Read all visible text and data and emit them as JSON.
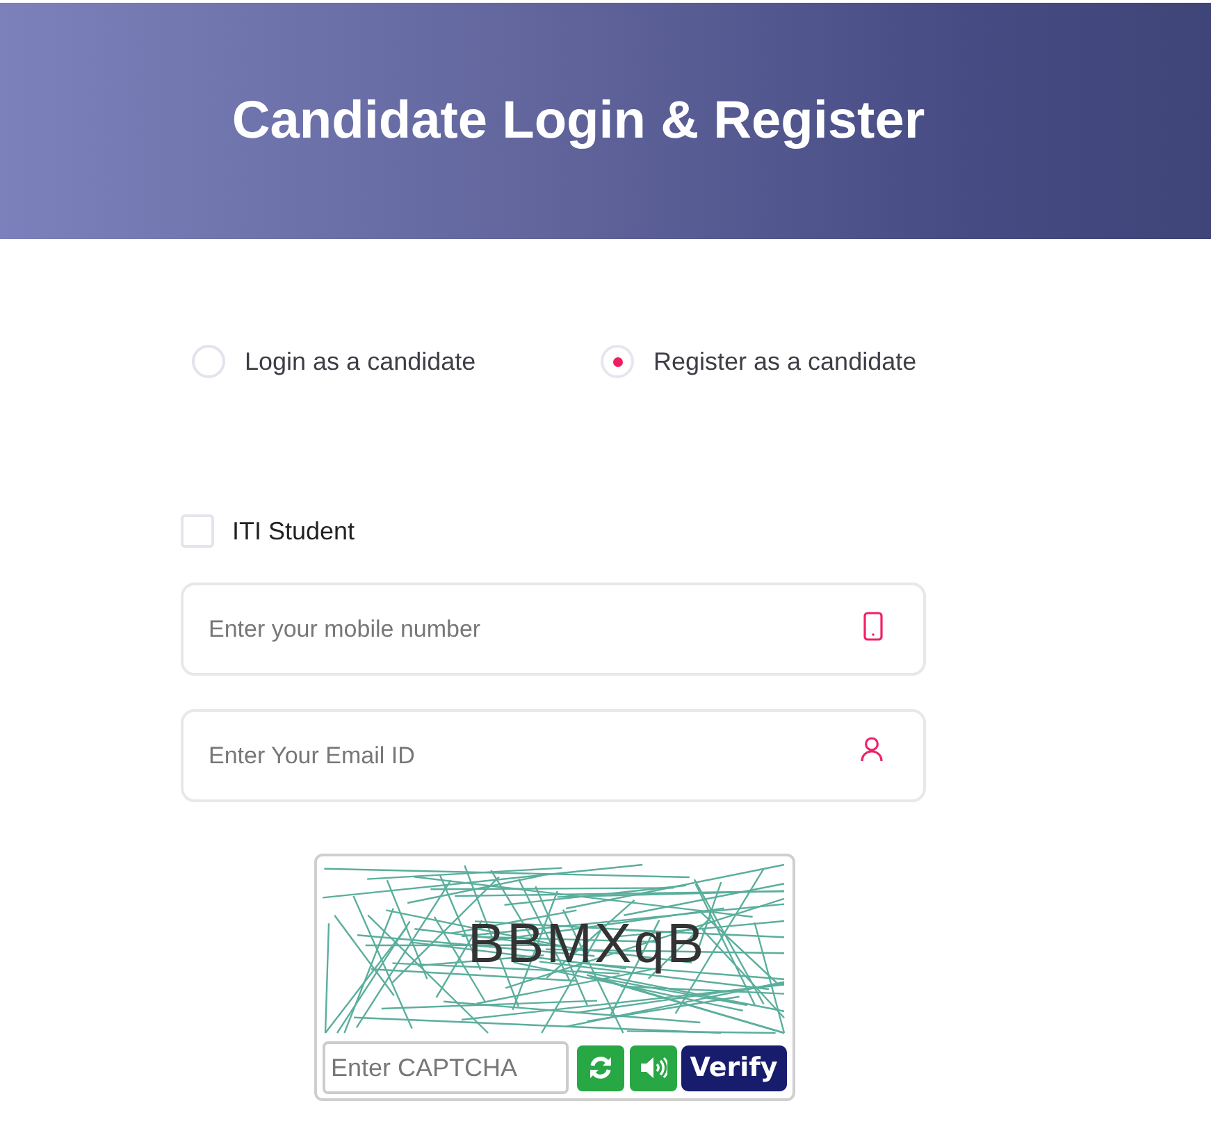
{
  "header": {
    "title": "Candidate Login & Register"
  },
  "mode_options": [
    {
      "label": "Login as a candidate",
      "selected": false
    },
    {
      "label": "Register as a candidate",
      "selected": true
    }
  ],
  "iti_student": {
    "label": "ITI Student",
    "checked": false
  },
  "fields": [
    {
      "kind": "phone",
      "placeholder": "Enter your mobile number"
    },
    {
      "kind": "user",
      "placeholder": "Enter Your Email ID"
    }
  ],
  "captcha": {
    "text": "BBMXqB",
    "placeholder": "Enter CAPTCHA",
    "buttons": [
      {
        "kind": "refresh"
      },
      {
        "kind": "audio"
      },
      {
        "kind": "verify",
        "label": "Verify"
      }
    ]
  }
}
